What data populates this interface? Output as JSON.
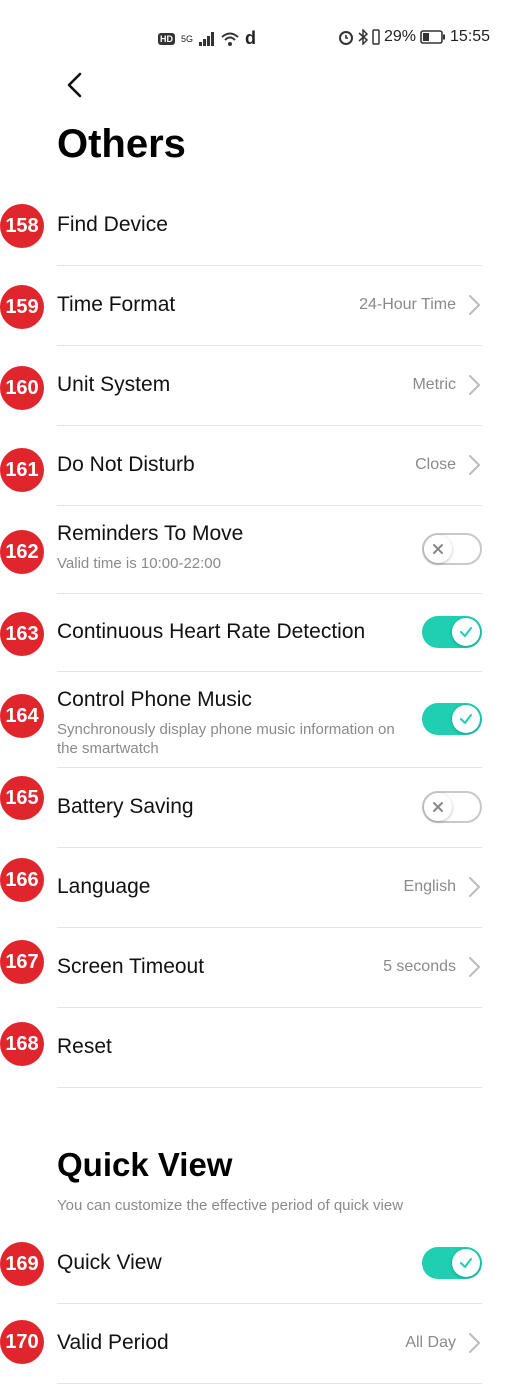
{
  "statusbar": {
    "network": "5G",
    "hd": "HD",
    "extra": "d",
    "battery": "29%",
    "time": "15:55"
  },
  "page": {
    "title": "Others"
  },
  "rows": [
    {
      "badge": "158",
      "label": "Find Device"
    },
    {
      "badge": "159",
      "label": "Time Format",
      "value": "24-Hour Time"
    },
    {
      "badge": "160",
      "label": "Unit System",
      "value": "Metric"
    },
    {
      "badge": "161",
      "label": "Do Not Disturb",
      "value": "Close"
    },
    {
      "badge": "162",
      "label": "Reminders To Move",
      "sub": "Valid time is 10:00-22:00",
      "toggle": "off"
    },
    {
      "badge": "163",
      "label": "Continuous Heart Rate Detection",
      "toggle": "on"
    },
    {
      "badge": "164",
      "label": "Control Phone Music",
      "sub": "Synchronously display phone music information on the smartwatch",
      "toggle": "on"
    },
    {
      "badge": "165",
      "label": "Battery Saving",
      "toggle": "off"
    },
    {
      "badge": "166",
      "label": "Language",
      "value": "English"
    },
    {
      "badge": "167",
      "label": "Screen Timeout",
      "value": "5 seconds"
    },
    {
      "badge": "168",
      "label": "Reset"
    }
  ],
  "quick_view": {
    "title": "Quick View",
    "description": "You can customize the effective period of quick view",
    "rows": [
      {
        "badge": "169",
        "label": "Quick View",
        "toggle": "on"
      },
      {
        "badge": "170",
        "label": "Valid Period",
        "value": "All Day"
      }
    ]
  },
  "colors": {
    "toggle_on": "#1ecfb1",
    "badge": "#e0252c"
  },
  "icons": {
    "back": "chevron-left-icon",
    "row_arrow": "chevron-right-icon",
    "check": "check-icon",
    "cross": "x-icon"
  }
}
